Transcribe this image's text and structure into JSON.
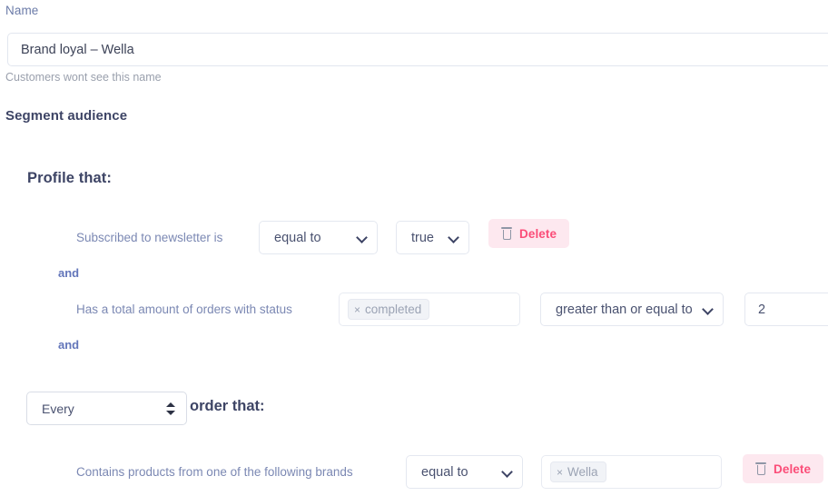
{
  "name_field": {
    "label": "Name",
    "value": "Brand loyal – Wella",
    "placeholder": "",
    "help_text": "Customers wont see this name"
  },
  "segment": {
    "section_title": "Segment audience",
    "profile_title": "Profile that:",
    "connector_and": "and",
    "conditions": [
      {
        "label": "Subscribed to newsletter is",
        "operator": "equal to",
        "value": "true",
        "delete_label": "Delete"
      },
      {
        "label": "Has a total amount of orders with status",
        "token": "completed",
        "token_remove": "×",
        "operator": "greater than or equal to",
        "amount": "2"
      }
    ]
  },
  "order_block": {
    "scope": "Every",
    "title": "order that:",
    "condition": {
      "label": "Contains products from one of the following brands",
      "operator": "equal to",
      "token": "Wella",
      "token_remove": "×",
      "delete_label": "Delete"
    }
  },
  "colors": {
    "accent_pink": "#fb4d78",
    "delete_bg": "#fde8ef",
    "label_blue": "#7b88b3",
    "heading": "#3d4465",
    "connector": "#6376ba",
    "border": "#e4e8f0",
    "token_bg": "#f1f3f7"
  }
}
